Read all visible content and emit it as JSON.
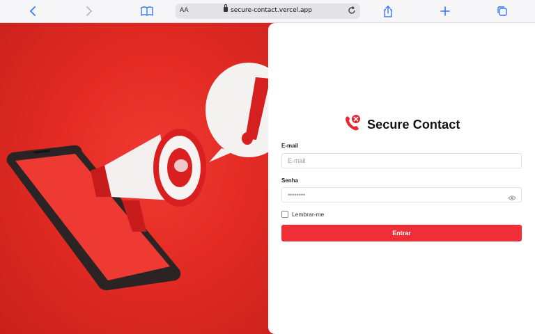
{
  "browser": {
    "text_size_label": "AA",
    "url": "secure-contact.vercel.app",
    "accent_color": "#3478f6"
  },
  "brand": {
    "name": "Secure Contact",
    "icon": "phone-blocked-icon",
    "accent_color": "#ef2e38"
  },
  "form": {
    "email_label": "E-mail",
    "email_placeholder": "E-mail",
    "password_label": "Senha",
    "password_placeholder": "••••••••",
    "remember_label": "Lembrar-me",
    "submit_label": "Entrar"
  },
  "hero": {
    "illustration": "megaphone-and-phone-alert",
    "background_color": "#e32b24"
  }
}
